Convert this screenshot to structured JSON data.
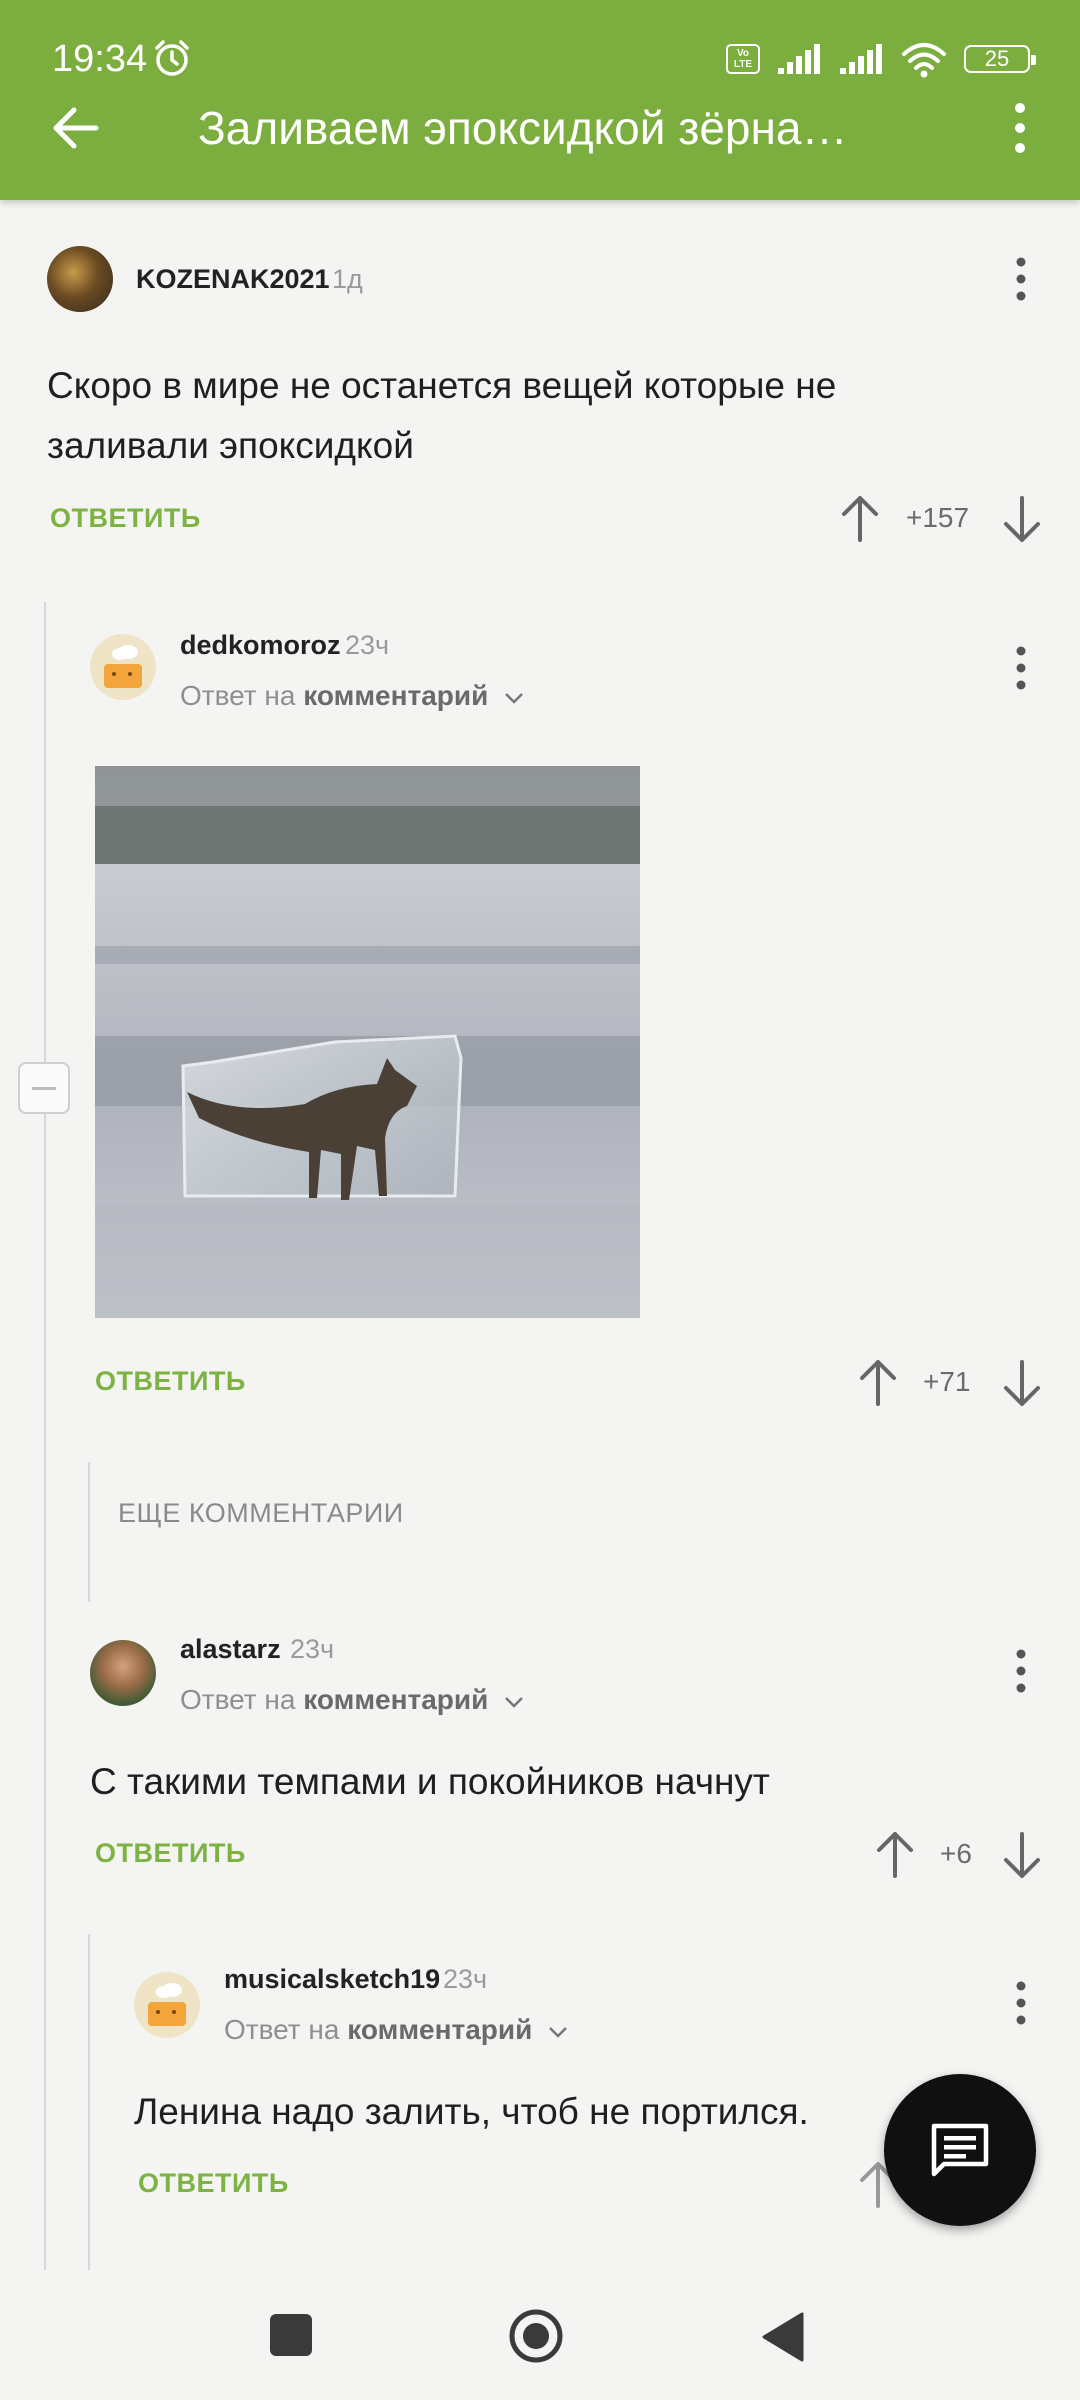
{
  "status_bar": {
    "time": "19:34",
    "volte": "Vo LTE",
    "battery": "25"
  },
  "header": {
    "title": "Заливаем эпоксидкой зёрна…"
  },
  "colors": {
    "brand_green": "#7cad3f",
    "reply_green": "#7cb342"
  },
  "comments": [
    {
      "username": "KOZENAK2021",
      "time": "1д",
      "text": "Скоро в мире не останется вещей которые не заливали эпоксидкой",
      "reply_label": "ОТВЕТИТЬ",
      "score": "+157"
    },
    {
      "username": "dedkomoroz",
      "time": "23ч",
      "reply_prefix": "Ответ на",
      "reply_target": "комментарий",
      "reply_label": "ОТВЕТИТЬ",
      "score": "+71"
    },
    {
      "username": "alastarz",
      "time": "23ч",
      "reply_prefix": "Ответ на",
      "reply_target": "комментарий",
      "text": "С такими темпами и покойников начнут",
      "reply_label": "ОТВЕТИТЬ",
      "score": "+6"
    },
    {
      "username": "musicalsketch19",
      "time": "23ч",
      "reply_prefix": "Ответ на",
      "reply_target": "комментарий",
      "text": "Ленина надо залить, чтоб не портился.",
      "reply_label": "ОТВЕТИТЬ"
    }
  ],
  "more_comments_label": "ЕЩЕ КОММЕНТАРИИ",
  "icons": {
    "alarm": "alarm-icon",
    "back": "arrow-left-icon",
    "menu": "more-vertical-icon",
    "upvote": "arrow-up-icon",
    "downvote": "arrow-down-icon",
    "fab": "comment-icon",
    "nav_recent": "square-icon",
    "nav_home": "circle-icon",
    "nav_back": "triangle-back-icon"
  }
}
